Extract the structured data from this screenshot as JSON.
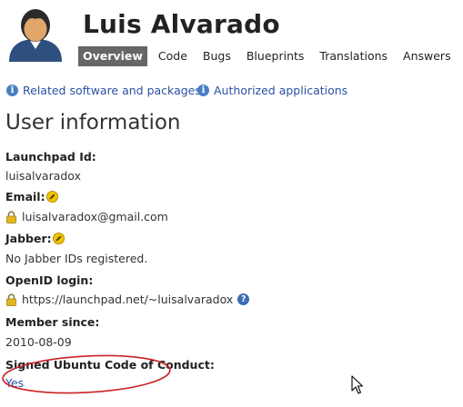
{
  "profile": {
    "name": "Luis Alvarado"
  },
  "tabs": [
    {
      "label": "Overview",
      "active": true
    },
    {
      "label": "Code"
    },
    {
      "label": "Bugs"
    },
    {
      "label": "Blueprints"
    },
    {
      "label": "Translations"
    },
    {
      "label": "Answers"
    }
  ],
  "links": {
    "related": "Related software and packages",
    "authorized": "Authorized applications"
  },
  "section_title": "User information",
  "fields": {
    "launchpad_id": {
      "label": "Launchpad Id:",
      "value": "luisalvaradox"
    },
    "email": {
      "label": "Email:",
      "value": "luisalvaradox@gmail.com"
    },
    "jabber": {
      "label": "Jabber:",
      "value": "No Jabber IDs registered."
    },
    "openid": {
      "label": "OpenID login:",
      "value": "https://launchpad.net/~luisalvaradox"
    },
    "member_since": {
      "label": "Member since:",
      "value": "2010-08-09"
    },
    "code_of_conduct": {
      "label": "Signed Ubuntu Code of Conduct:",
      "value": "Yes"
    }
  },
  "colors": {
    "link": "#2a51a3",
    "active_tab_bg": "#666666",
    "annotation_circle": "#cc2222",
    "edit_icon": "#f2c500"
  },
  "icons": {
    "avatar": "user-avatar-icon",
    "info": "info-icon",
    "edit": "pencil-edit-icon",
    "lock": "padlock-icon",
    "help": "question-help-icon",
    "cursor": "mouse-pointer-icon"
  }
}
